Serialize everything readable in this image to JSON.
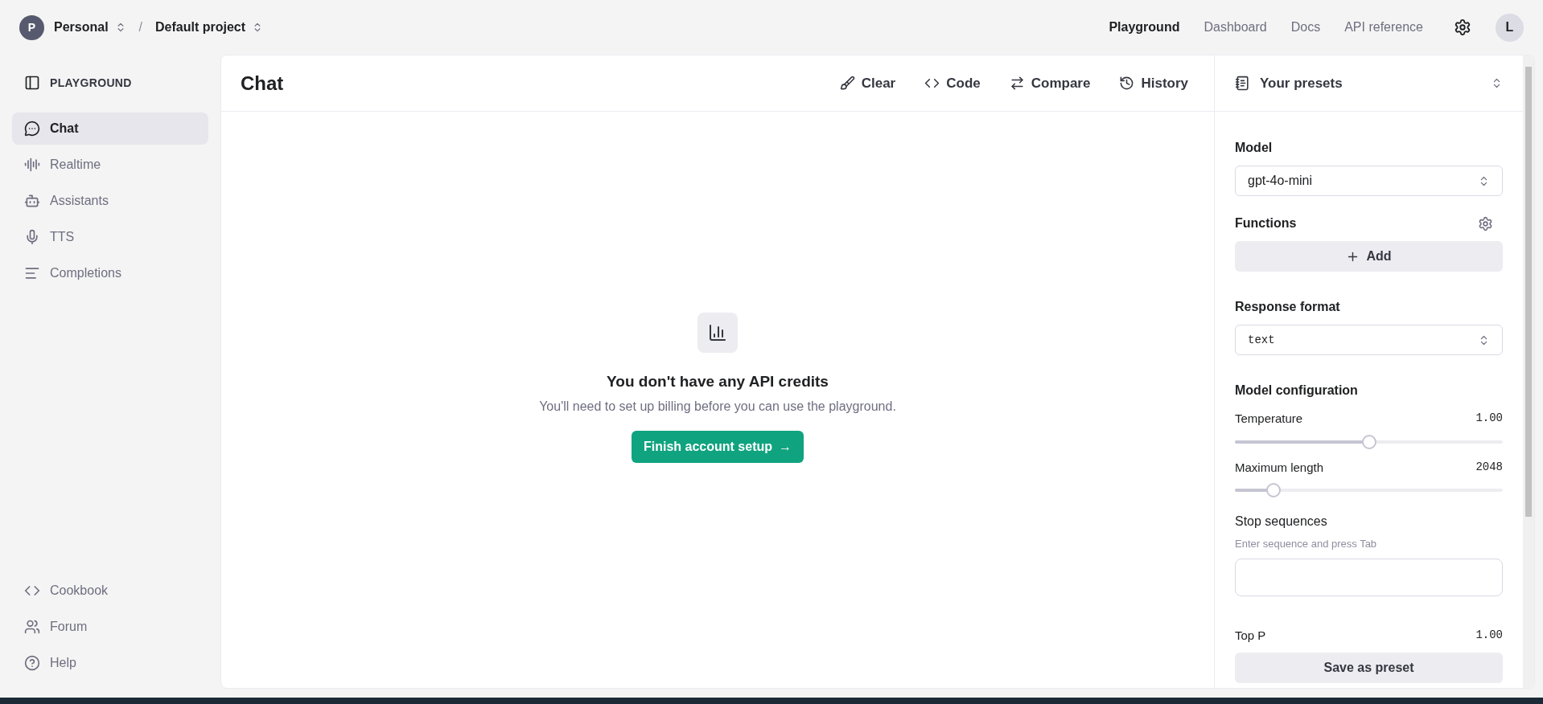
{
  "breadcrumb": {
    "avatar": "P",
    "organization": "Personal",
    "separator": "/",
    "project": "Default project"
  },
  "top_nav": [
    {
      "label": "Playground",
      "selected": true
    },
    {
      "label": "Dashboard",
      "selected": false
    },
    {
      "label": "Docs",
      "selected": false
    },
    {
      "label": "API reference",
      "selected": false
    }
  ],
  "user_avatar": "L",
  "sidebar": {
    "title": "PLAYGROUND",
    "items": [
      {
        "label": "Chat",
        "selected": true
      },
      {
        "label": "Realtime",
        "selected": false
      },
      {
        "label": "Assistants",
        "selected": false
      },
      {
        "label": "TTS",
        "selected": false
      },
      {
        "label": "Completions",
        "selected": false
      }
    ],
    "footer_items": [
      "Cookbook",
      "Forum",
      "Help"
    ]
  },
  "chat": {
    "title": "Chat",
    "toolbar": [
      "Clear",
      "Code",
      "Compare",
      "History"
    ],
    "empty_state": {
      "heading": "You don't have any API credits",
      "message": "You'll need to set up billing before you can use the playground.",
      "button": "Finish account setup",
      "button_arrow": "→"
    }
  },
  "settings": {
    "presets": "Your presets",
    "model_label": "Model",
    "model": "gpt-4o-mini",
    "functions_label": "Functions",
    "add_button": "Add",
    "response_format_label": "Response format",
    "response_format": "text",
    "config_label": "Model configuration",
    "sliders": [
      {
        "label": "Temperature",
        "reading": "1.00",
        "level": 0.5
      },
      {
        "label": "Maximum length",
        "reading": "2048",
        "level": 0.144
      }
    ],
    "stop_label": "Stop sequences",
    "stop_hint": "Enter sequence and press Tab",
    "top_p_label": "Top P",
    "top_p_reading": "1.00",
    "save_button": "Save as preset"
  }
}
